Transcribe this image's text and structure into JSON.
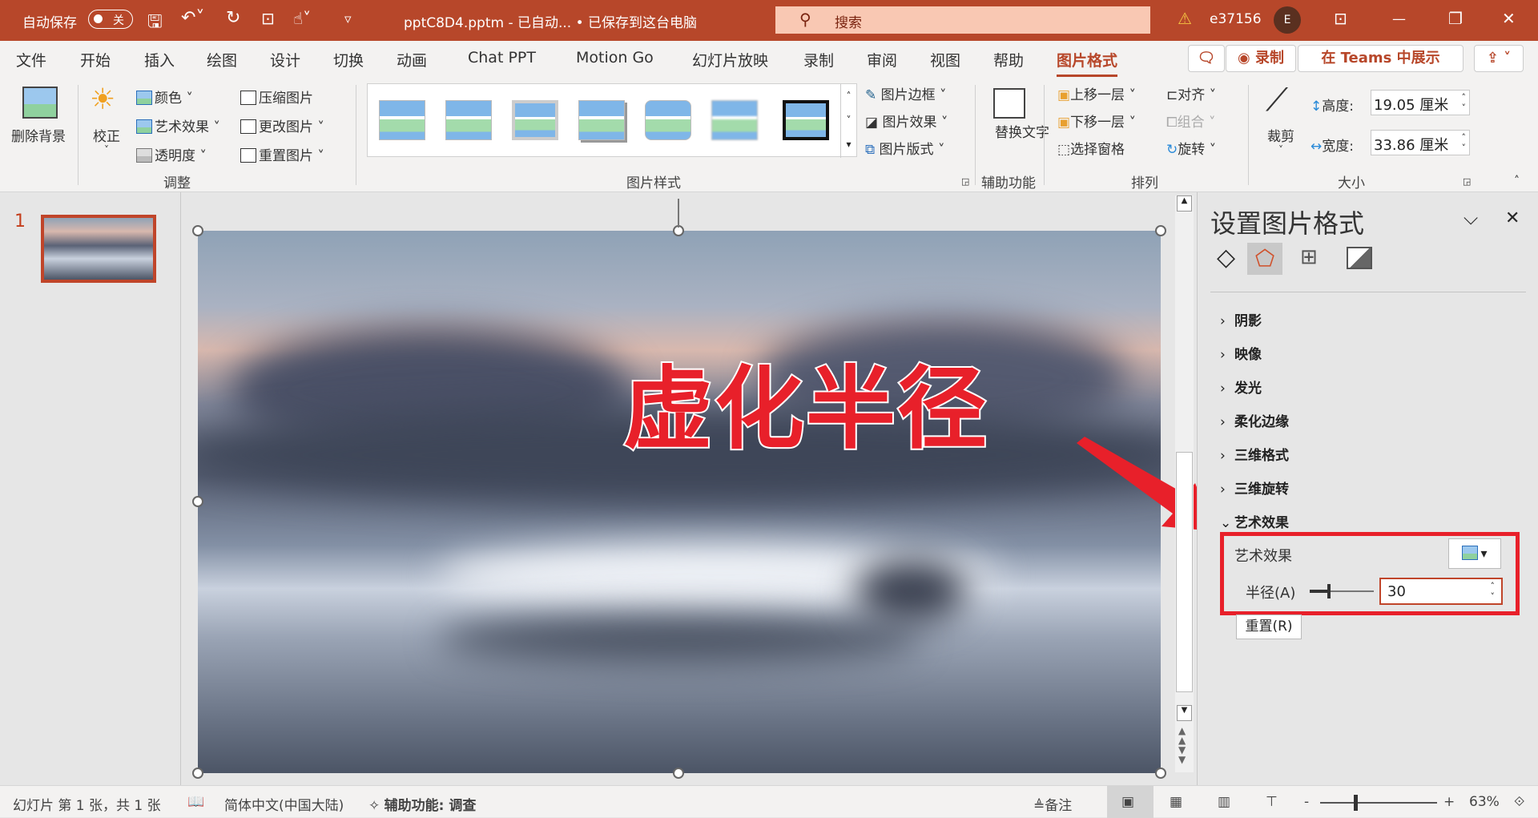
{
  "titlebar": {
    "autosave_label": "自动保存",
    "autosave_state": "关",
    "doc_title": "pptC8D4.pptm  -  已自动...  • 已保存到这台电脑",
    "search_placeholder": "搜索",
    "user": "e37156",
    "avatar_initial": "E"
  },
  "tabs": [
    {
      "label": "文件"
    },
    {
      "label": "开始"
    },
    {
      "label": "插入"
    },
    {
      "label": "绘图"
    },
    {
      "label": "设计"
    },
    {
      "label": "切换"
    },
    {
      "label": "动画"
    },
    {
      "label": "Chat PPT"
    },
    {
      "label": "Motion Go"
    },
    {
      "label": "幻灯片放映"
    },
    {
      "label": "录制"
    },
    {
      "label": "审阅"
    },
    {
      "label": "视图"
    },
    {
      "label": "帮助"
    },
    {
      "label": "图片格式",
      "active": true
    }
  ],
  "tab_buttons": {
    "record": "◉ 录制",
    "teams": "在 Teams 中展示"
  },
  "ribbon": {
    "remove_bg": "删除背景",
    "correct": "校正",
    "color": "颜色",
    "artistic": "艺术效果",
    "transparency": "透明度",
    "compress": "压缩图片",
    "change": "更改图片",
    "reset": "重置图片",
    "group_adjust": "调整",
    "group_styles": "图片样式",
    "border": "图片边框",
    "effects": "图片效果",
    "layout": "图片版式",
    "alt_text": "替换文字",
    "group_access": "辅助功能",
    "forward": "上移一层",
    "backward": "下移一层",
    "selection": "选择窗格",
    "align": "对齐",
    "group": "组合",
    "rotate": "旋转",
    "group_arrange": "排列",
    "crop": "裁剪",
    "height_label": "高度:",
    "height_value": "19.05 厘米",
    "width_label": "宽度:",
    "width_value": "33.86 厘米",
    "group_size": "大小"
  },
  "slides": [
    {
      "number": "1"
    }
  ],
  "slide": {
    "overlay_text": "虚化半径"
  },
  "pane": {
    "title": "设置图片格式",
    "sections": [
      {
        "label": "阴影"
      },
      {
        "label": "映像"
      },
      {
        "label": "发光"
      },
      {
        "label": "柔化边缘"
      },
      {
        "label": "三维格式"
      },
      {
        "label": "三维旋转"
      },
      {
        "label": "艺术效果",
        "expanded": true
      }
    ],
    "artistic_label": "艺术效果",
    "radius_label": "半径(A)",
    "radius_value": "30",
    "radius_fraction": 0.3,
    "reset_label": "重置(R)"
  },
  "status": {
    "slide_info": "幻灯片 第 1 张，共 1 张",
    "language": "简体中文(中国大陆)",
    "accessibility": "辅助功能: 调查",
    "notes": "备注",
    "zoom": "63%"
  },
  "colors": {
    "accent": "#b7472a",
    "highlight": "#e8202a"
  }
}
